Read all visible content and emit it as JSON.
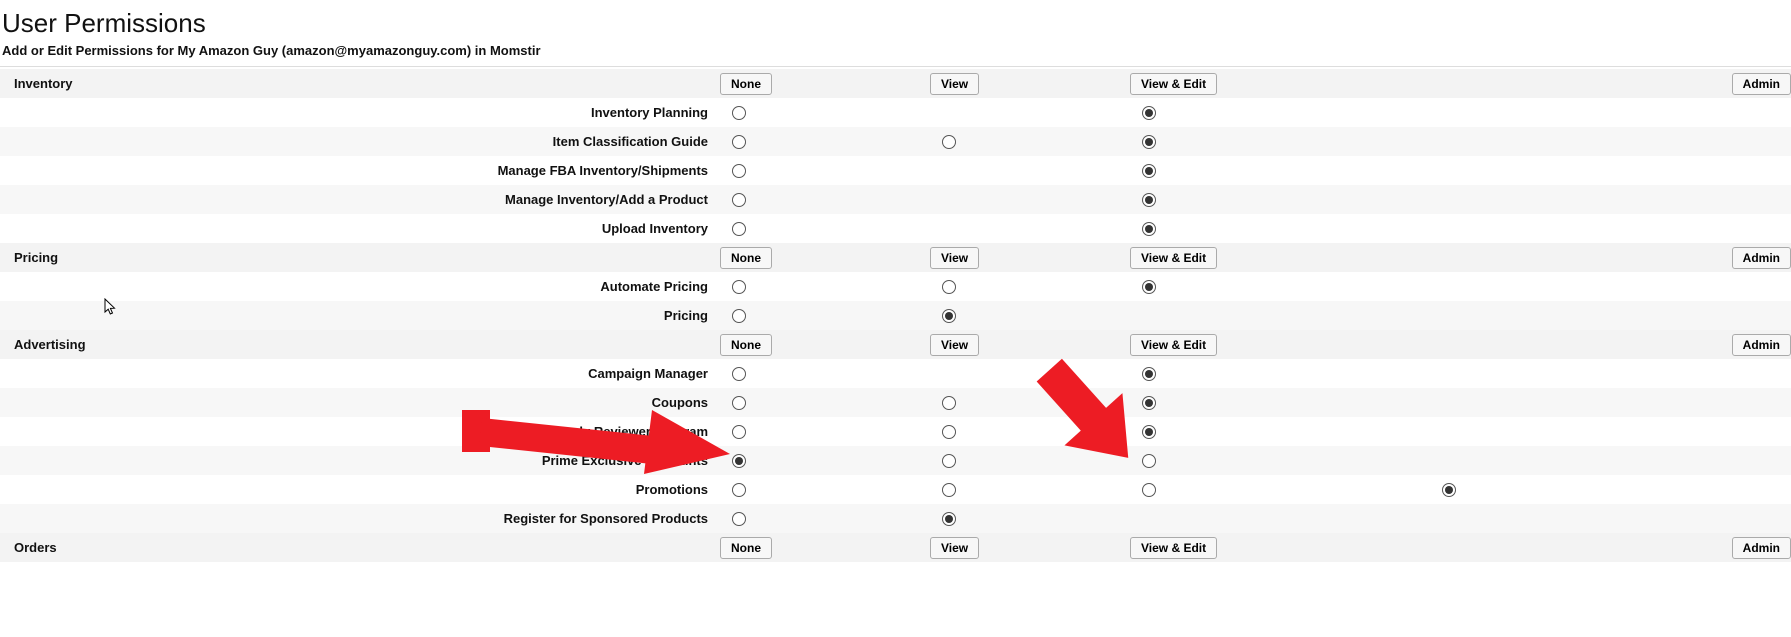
{
  "page": {
    "title": "User Permissions",
    "subtitle": "Add or Edit Permissions for My Amazon Guy (amazon@myamazonguy.com) in Momstir"
  },
  "buttons": {
    "none": "None",
    "view": "View",
    "view_edit": "View & Edit",
    "admin": "Admin"
  },
  "sections": [
    {
      "name": "Inventory",
      "rows": [
        {
          "label": "Inventory Planning",
          "none": "o",
          "view": "",
          "edit": "x",
          "admin": ""
        },
        {
          "label": "Item Classification Guide",
          "none": "o",
          "view": "o",
          "edit": "x",
          "admin": ""
        },
        {
          "label": "Manage FBA Inventory/Shipments",
          "none": "o",
          "view": "",
          "edit": "x",
          "admin": ""
        },
        {
          "label": "Manage Inventory/Add a Product",
          "none": "o",
          "view": "",
          "edit": "x",
          "admin": ""
        },
        {
          "label": "Upload Inventory",
          "none": "o",
          "view": "",
          "edit": "x",
          "admin": ""
        }
      ]
    },
    {
      "name": "Pricing",
      "rows": [
        {
          "label": "Automate Pricing",
          "none": "o",
          "view": "o",
          "edit": "x",
          "admin": ""
        },
        {
          "label": "Pricing",
          "none": "o",
          "view": "x",
          "edit": "",
          "admin": ""
        }
      ]
    },
    {
      "name": "Advertising",
      "rows": [
        {
          "label": "Campaign Manager",
          "none": "o",
          "view": "",
          "edit": "x",
          "admin": ""
        },
        {
          "label": "Coupons",
          "none": "o",
          "view": "o",
          "edit": "x",
          "admin": ""
        },
        {
          "label": "Early Reviewer Program",
          "none": "o",
          "view": "o",
          "edit": "x",
          "admin": ""
        },
        {
          "label": "Prime Exclusive Discounts",
          "none": "x",
          "view": "o",
          "edit": "o",
          "admin": ""
        },
        {
          "label": "Promotions",
          "none": "o",
          "view": "o",
          "edit": "o",
          "admin": "x"
        },
        {
          "label": "Register for Sponsored Products",
          "none": "o",
          "view": "x",
          "edit": "",
          "admin": ""
        }
      ]
    },
    {
      "name": "Orders",
      "rows": []
    }
  ]
}
